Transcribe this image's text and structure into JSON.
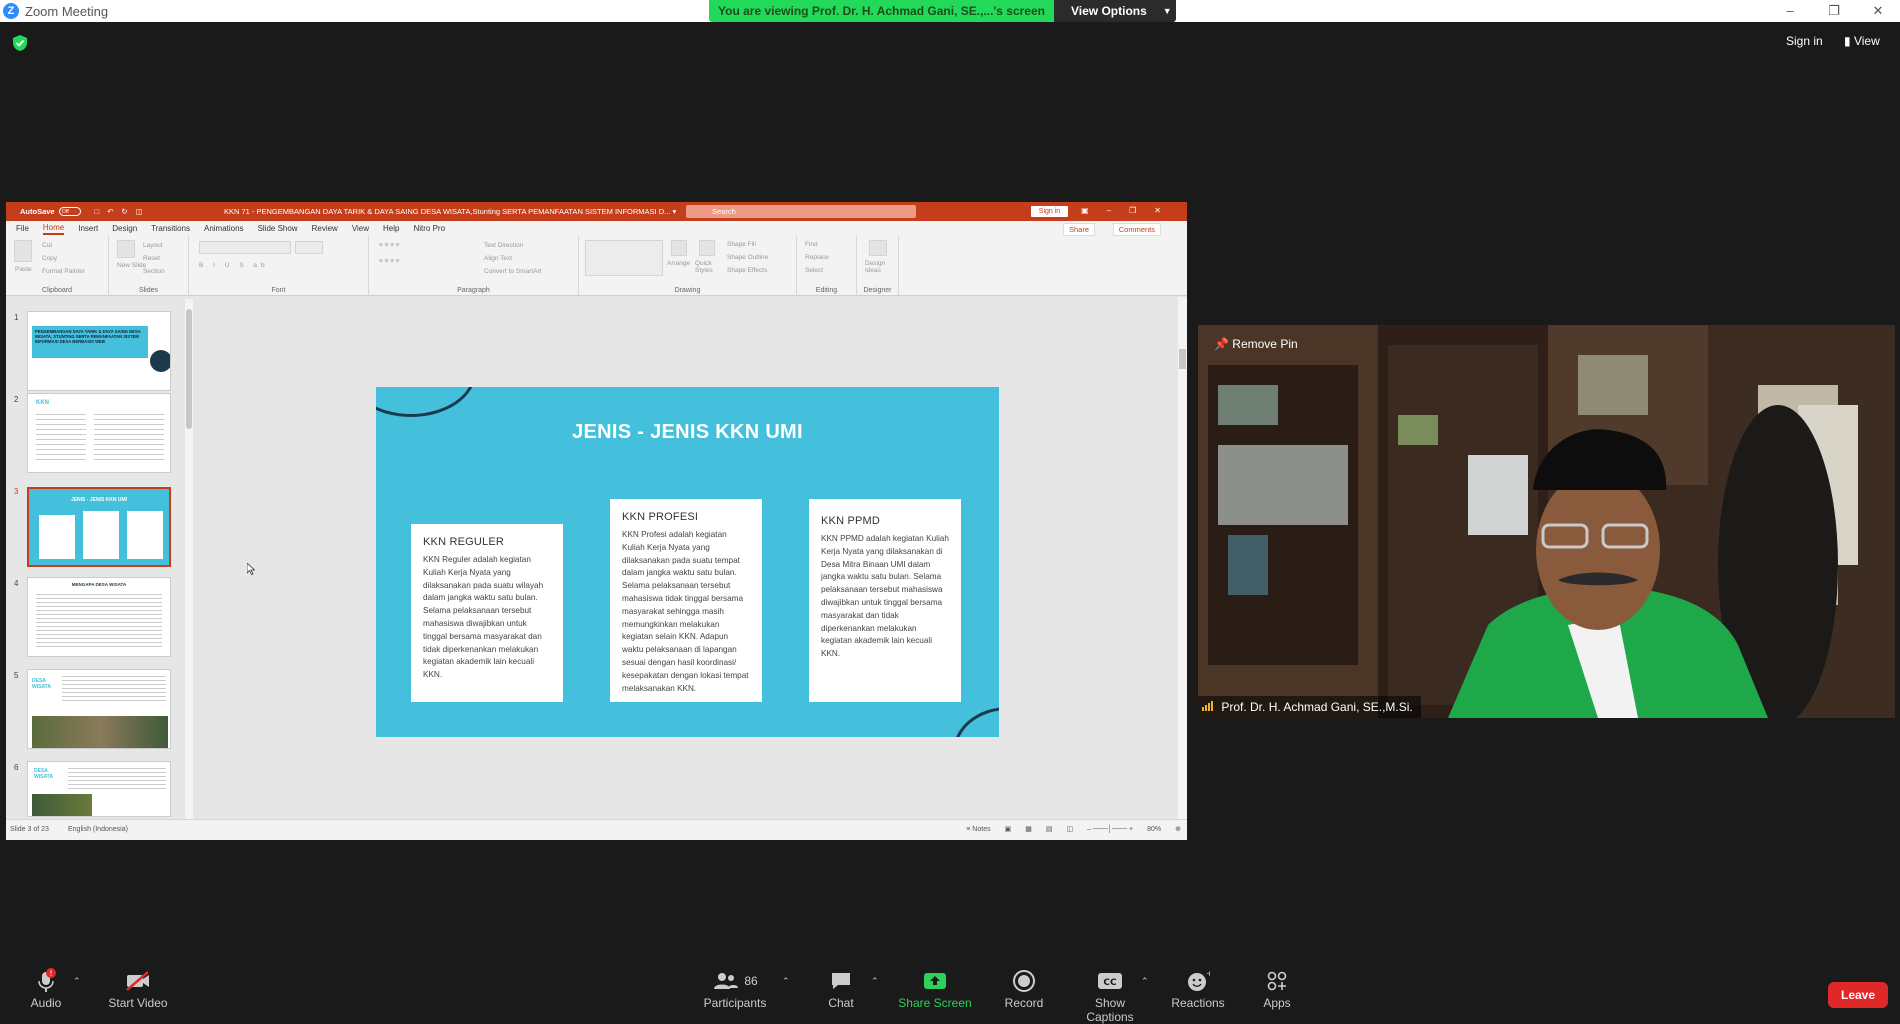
{
  "window": {
    "title": "Zoom Meeting",
    "logo_letter": "Z"
  },
  "banner": {
    "viewing_text": "You are viewing Prof. Dr. H. Achmad Gani, SE.,...'s screen",
    "view_options_label": "View Options"
  },
  "top_right": {
    "sign_in": "Sign in",
    "view": "View"
  },
  "ppt": {
    "autosave_label": "AutoSave",
    "autosave_state": "Off",
    "doc_title": "KKN 71 - PENGEMBANGAN DAYA TARIK & DAYA SAING DESA WISATA,Stunting SERTA PEMANFAATAN SISTEM INFORMASI D... ▾",
    "search_placeholder": "Search",
    "sign_in": "Sign in",
    "menu": [
      "File",
      "Home",
      "Insert",
      "Design",
      "Transitions",
      "Animations",
      "Slide Show",
      "Review",
      "View",
      "Help",
      "Nitro Pro"
    ],
    "share": "Share",
    "comments": "Comments",
    "ribbon_groups": [
      "Clipboard",
      "Slides",
      "Font",
      "Paragraph",
      "Drawing",
      "Editing",
      "Designer"
    ],
    "ribbon_items": {
      "paste": "Paste",
      "cut": "Cut",
      "copy": "Copy",
      "format_painter": "Format Painter",
      "new_slide": "New Slide",
      "layout": "Layout",
      "reset": "Reset",
      "section": "Section",
      "text_direction": "Text Direction",
      "align_text": "Align Text",
      "convert_smartart": "Convert to SmartArt",
      "arrange": "Arrange",
      "quick_styles": "Quick Styles",
      "shape_fill": "Shape Fill",
      "shape_outline": "Shape Outline",
      "shape_effects": "Shape Effects",
      "find": "Find",
      "replace": "Replace",
      "select": "Select",
      "design_ideas": "Design Ideas"
    },
    "thumbnails": [
      "1",
      "2",
      "3",
      "4",
      "5",
      "6"
    ],
    "thumb_texts": {
      "t1": "PENGEMBANGAN DAYA TARIK & DAYA SAING DESA WISATA, STUNTING SERTA PEMANFAATAN SISTEM INFORMASI DESA BERBASIS WEB",
      "t2": "KKN",
      "t3": "JENIS - JENIS KKN UMI",
      "t4": "MENGAPA DESA WISATA",
      "t5": "DESA WISATA",
      "t6": "DESA WISATA"
    },
    "status": {
      "slide_of": "Slide 3 of 23",
      "language": "English (Indonesia)",
      "notes": "Notes",
      "zoom": "80%"
    }
  },
  "slide": {
    "title": "JENIS - JENIS KKN UMI",
    "cards": [
      {
        "title": "KKN REGULER",
        "body": "KKN Reguler adalah kegiatan Kuliah Kerja Nyata yang dilaksanakan pada suatu wilayah dalam jangka waktu satu bulan. Selama pelaksanaan tersebut mahasiswa diwajibkan untuk tinggal bersama masyarakat dan tidak diperkenankan melakukan kegiatan akademik lain kecuali KKN."
      },
      {
        "title": "KKN PROFESI",
        "body": "KKN Profesi adalah kegiatan Kuliah Kerja Nyata yang dilaksanakan pada suatu tempat dalam jangka waktu satu bulan. Selama pelaksanaan tersebut mahasiswa tidak tinggal bersama masyarakat sehingga masih memungkinkan melakukan kegiatan selain KKN. Adapun waktu pelaksanaan di lapangan sesuai dengan hasil koordinasi/ kesepakatan dengan lokasi tempat melaksanakan KKN."
      },
      {
        "title": "KKN PPMD",
        "body": "KKN PPMD adalah kegiatan Kuliah Kerja Nyata yang dilaksanakan di Desa Mitra Binaan UMI dalam jangka waktu satu bulan. Selama pelaksanaan tersebut mahasiswa diwajibkan untuk tinggal bersama masyarakat dan tidak diperkenankan melakukan kegiatan akademik lain kecuali KKN."
      }
    ]
  },
  "video": {
    "remove_pin": "Remove Pin",
    "participant_name": "Prof. Dr. H. Achmad Gani, SE.,M.Si."
  },
  "toolbar": {
    "audio": "Audio",
    "start_video": "Start Video",
    "participants": "Participants",
    "participants_count": "86",
    "chat": "Chat",
    "share_screen": "Share Screen",
    "record": "Record",
    "show_captions": "Show Captions",
    "reactions": "Reactions",
    "apps": "Apps",
    "leave": "Leave"
  },
  "colors": {
    "zoom_blue": "#2d8cff",
    "banner_green": "#23d959",
    "ppt_red": "#c43e1c",
    "slide_cyan": "#44bfdc",
    "leave_red": "#e02828"
  }
}
